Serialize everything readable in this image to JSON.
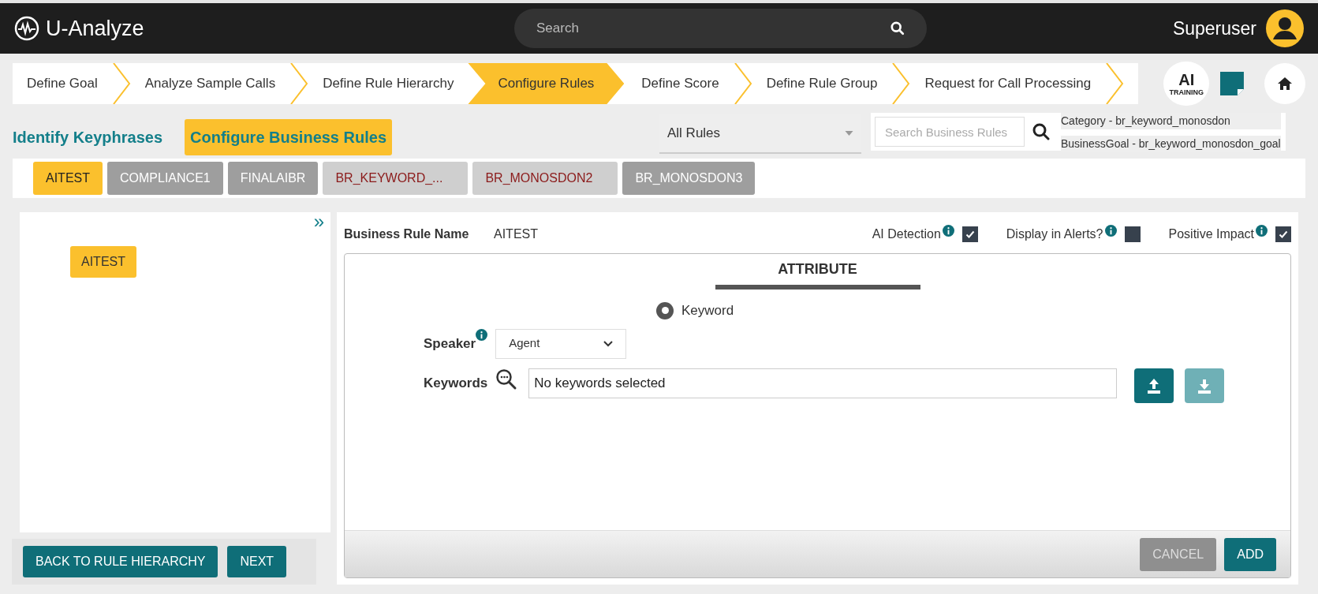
{
  "app": {
    "title": "U-Analyze"
  },
  "search": {
    "placeholder": "Search"
  },
  "user": {
    "name": "Superuser"
  },
  "steps": [
    {
      "label": "Define Goal",
      "selected": false
    },
    {
      "label": "Analyze Sample Calls",
      "selected": false
    },
    {
      "label": "Define Rule Hierarchy",
      "selected": false
    },
    {
      "label": "Configure Rules",
      "selected": true
    },
    {
      "label": "Define Score",
      "selected": false
    },
    {
      "label": "Define Rule Group",
      "selected": false
    },
    {
      "label": "Request for Call Processing",
      "selected": false
    }
  ],
  "ai_badge": {
    "title": "AI",
    "subtitle": "TRAINING"
  },
  "subtabs": [
    {
      "label": "Identify Keyphrases",
      "selected": false
    },
    {
      "label": "Configure Business Rules",
      "selected": true
    }
  ],
  "rule_filter": {
    "value": "All Rules"
  },
  "rule_search": {
    "placeholder": "Search Business Rules"
  },
  "info": [
    "Category - br_keyword_monosdon",
    "BusinessGoal - br_keyword_monosdon_goal"
  ],
  "rule_chips": [
    {
      "label": "AITEST",
      "selected": true,
      "kind": "standard"
    },
    {
      "label": "COMPLIANCE1",
      "selected": false,
      "kind": "standard"
    },
    {
      "label": "FINALAIBR",
      "selected": false,
      "kind": "standard"
    },
    {
      "label": "BR_KEYWORD_...",
      "selected": false,
      "kind": "incomplete"
    },
    {
      "label": "BR_MONOSDON2",
      "selected": false,
      "kind": "incomplete"
    },
    {
      "label": "BR_MONOSDON3",
      "selected": false,
      "kind": "standard"
    }
  ],
  "collapse": {
    "glyph": "»"
  },
  "tree": {
    "items": [
      {
        "label": "AITEST"
      }
    ]
  },
  "rule_form": {
    "name_label": "Business Rule Name",
    "name_value": "AITEST",
    "flags": [
      {
        "label": "AI Detection",
        "checked": true
      },
      {
        "label": "Display in Alerts?",
        "checked": false
      },
      {
        "label": "Positive Impact",
        "checked": true
      }
    ],
    "section_title": "ATTRIBUTE",
    "radio": {
      "label": "Keyword",
      "selected": true
    },
    "speaker": {
      "label": "Speaker",
      "value": "Agent"
    },
    "keywords": {
      "label": "Keywords",
      "value": "No keywords selected"
    },
    "buttons": [
      {
        "label": "CANCEL",
        "disabled": true
      },
      {
        "label": "ADD",
        "disabled": false
      }
    ]
  },
  "nav_buttons": [
    "BACK TO RULE HIERARCHY",
    "NEXT"
  ]
}
